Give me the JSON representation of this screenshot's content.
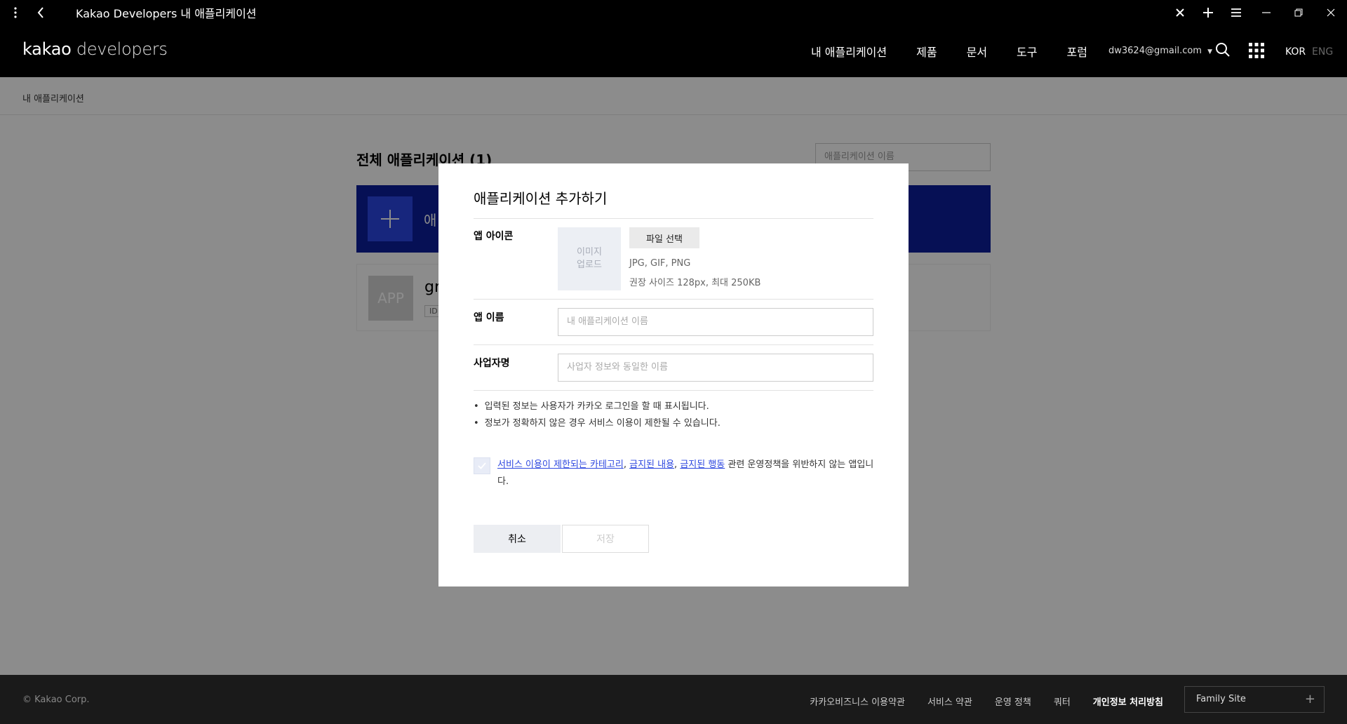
{
  "browser": {
    "title": "Kakao Developers 내 애플리케이션"
  },
  "header": {
    "logo_strong": "kakao",
    "logo_light": " developers",
    "nav": [
      "내 애플리케이션",
      "제품",
      "문서",
      "도구",
      "포럼"
    ],
    "user": "dw3624@gmail.com",
    "lang_active": "KOR",
    "lang_inactive": "ENG"
  },
  "breadcrumb": "내 애플리케이션",
  "main": {
    "title": "전체 애플리케이션 (1)",
    "search_placeholder": "애플리케이션 이름",
    "add_label": "애",
    "app": {
      "thumb": "APP",
      "name_partial": "gr",
      "id_partial": "ID"
    }
  },
  "modal": {
    "title": "애플리케이션 추가하기",
    "icon_label": "앱 아이콘",
    "icon_upload_line1": "이미지",
    "icon_upload_line2": "업로드",
    "file_button": "파일 선택",
    "hint_formats": "JPG, GIF, PNG",
    "hint_size": "권장 사이즈 128px, 최대 250KB",
    "name_label": "앱 이름",
    "name_placeholder": "내 애플리케이션 이름",
    "company_label": "사업자명",
    "company_placeholder": "사업자 정보와 동일한 이름",
    "notes": [
      "입력된 정보는 사용자가 카카오 로그인을 할 때 표시됩니다.",
      "정보가 정확하지 않은 경우 서비스 이용이 제한될 수 있습니다."
    ],
    "consent": {
      "link1": "서비스 이용이 제한되는 카테고리",
      "sep1": ", ",
      "link2": "금지된 내용",
      "sep2": ", ",
      "link3": "금지된 행동",
      "tail": " 관련 운영정책을 위반하지 않는 앱입니다."
    },
    "cancel": "취소",
    "save": "저장"
  },
  "footer": {
    "copyright": "© Kakao Corp.",
    "links": [
      "카카오비즈니스 이용약관",
      "서비스 약관",
      "운영 정책",
      "쿼터",
      "개인정보 처리방침"
    ],
    "family": "Family Site"
  },
  "colors": {
    "brand_navy": "#0b1e9c",
    "accent_blue": "#2b46e4",
    "link_blue": "#2f49e0"
  }
}
